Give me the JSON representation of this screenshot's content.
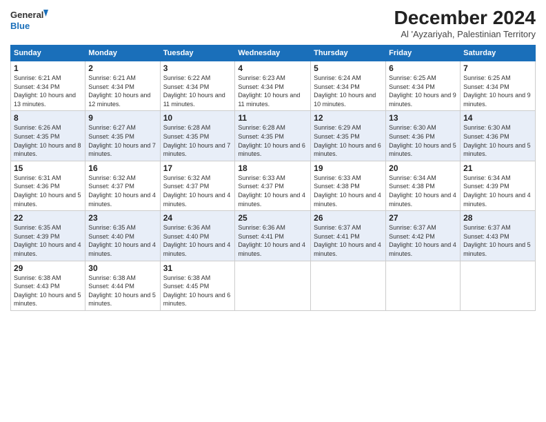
{
  "logo": {
    "line1": "General",
    "line2": "Blue"
  },
  "title": "December 2024",
  "subtitle": "Al 'Ayzariyah, Palestinian Territory",
  "days_of_week": [
    "Sunday",
    "Monday",
    "Tuesday",
    "Wednesday",
    "Thursday",
    "Friday",
    "Saturday"
  ],
  "weeks": [
    [
      {
        "day": "1",
        "sunrise": "6:21 AM",
        "sunset": "4:34 PM",
        "daylight": "10 hours and 13 minutes."
      },
      {
        "day": "2",
        "sunrise": "6:21 AM",
        "sunset": "4:34 PM",
        "daylight": "10 hours and 12 minutes."
      },
      {
        "day": "3",
        "sunrise": "6:22 AM",
        "sunset": "4:34 PM",
        "daylight": "10 hours and 11 minutes."
      },
      {
        "day": "4",
        "sunrise": "6:23 AM",
        "sunset": "4:34 PM",
        "daylight": "10 hours and 11 minutes."
      },
      {
        "day": "5",
        "sunrise": "6:24 AM",
        "sunset": "4:34 PM",
        "daylight": "10 hours and 10 minutes."
      },
      {
        "day": "6",
        "sunrise": "6:25 AM",
        "sunset": "4:34 PM",
        "daylight": "10 hours and 9 minutes."
      },
      {
        "day": "7",
        "sunrise": "6:25 AM",
        "sunset": "4:34 PM",
        "daylight": "10 hours and 9 minutes."
      }
    ],
    [
      {
        "day": "8",
        "sunrise": "6:26 AM",
        "sunset": "4:35 PM",
        "daylight": "10 hours and 8 minutes."
      },
      {
        "day": "9",
        "sunrise": "6:27 AM",
        "sunset": "4:35 PM",
        "daylight": "10 hours and 7 minutes."
      },
      {
        "day": "10",
        "sunrise": "6:28 AM",
        "sunset": "4:35 PM",
        "daylight": "10 hours and 7 minutes."
      },
      {
        "day": "11",
        "sunrise": "6:28 AM",
        "sunset": "4:35 PM",
        "daylight": "10 hours and 6 minutes."
      },
      {
        "day": "12",
        "sunrise": "6:29 AM",
        "sunset": "4:35 PM",
        "daylight": "10 hours and 6 minutes."
      },
      {
        "day": "13",
        "sunrise": "6:30 AM",
        "sunset": "4:36 PM",
        "daylight": "10 hours and 5 minutes."
      },
      {
        "day": "14",
        "sunrise": "6:30 AM",
        "sunset": "4:36 PM",
        "daylight": "10 hours and 5 minutes."
      }
    ],
    [
      {
        "day": "15",
        "sunrise": "6:31 AM",
        "sunset": "4:36 PM",
        "daylight": "10 hours and 5 minutes."
      },
      {
        "day": "16",
        "sunrise": "6:32 AM",
        "sunset": "4:37 PM",
        "daylight": "10 hours and 4 minutes."
      },
      {
        "day": "17",
        "sunrise": "6:32 AM",
        "sunset": "4:37 PM",
        "daylight": "10 hours and 4 minutes."
      },
      {
        "day": "18",
        "sunrise": "6:33 AM",
        "sunset": "4:37 PM",
        "daylight": "10 hours and 4 minutes."
      },
      {
        "day": "19",
        "sunrise": "6:33 AM",
        "sunset": "4:38 PM",
        "daylight": "10 hours and 4 minutes."
      },
      {
        "day": "20",
        "sunrise": "6:34 AM",
        "sunset": "4:38 PM",
        "daylight": "10 hours and 4 minutes."
      },
      {
        "day": "21",
        "sunrise": "6:34 AM",
        "sunset": "4:39 PM",
        "daylight": "10 hours and 4 minutes."
      }
    ],
    [
      {
        "day": "22",
        "sunrise": "6:35 AM",
        "sunset": "4:39 PM",
        "daylight": "10 hours and 4 minutes."
      },
      {
        "day": "23",
        "sunrise": "6:35 AM",
        "sunset": "4:40 PM",
        "daylight": "10 hours and 4 minutes."
      },
      {
        "day": "24",
        "sunrise": "6:36 AM",
        "sunset": "4:40 PM",
        "daylight": "10 hours and 4 minutes."
      },
      {
        "day": "25",
        "sunrise": "6:36 AM",
        "sunset": "4:41 PM",
        "daylight": "10 hours and 4 minutes."
      },
      {
        "day": "26",
        "sunrise": "6:37 AM",
        "sunset": "4:41 PM",
        "daylight": "10 hours and 4 minutes."
      },
      {
        "day": "27",
        "sunrise": "6:37 AM",
        "sunset": "4:42 PM",
        "daylight": "10 hours and 4 minutes."
      },
      {
        "day": "28",
        "sunrise": "6:37 AM",
        "sunset": "4:43 PM",
        "daylight": "10 hours and 5 minutes."
      }
    ],
    [
      {
        "day": "29",
        "sunrise": "6:38 AM",
        "sunset": "4:43 PM",
        "daylight": "10 hours and 5 minutes."
      },
      {
        "day": "30",
        "sunrise": "6:38 AM",
        "sunset": "4:44 PM",
        "daylight": "10 hours and 5 minutes."
      },
      {
        "day": "31",
        "sunrise": "6:38 AM",
        "sunset": "4:45 PM",
        "daylight": "10 hours and 6 minutes."
      },
      null,
      null,
      null,
      null
    ]
  ]
}
